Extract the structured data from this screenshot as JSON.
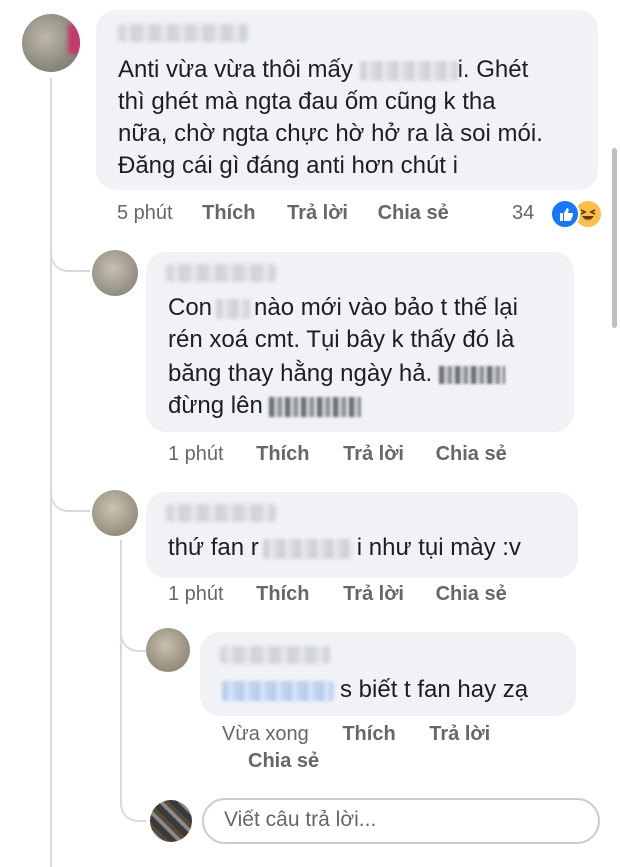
{
  "comments": [
    {
      "lines": [
        "Anti vừa vừa thôi mấy",
        "i. Ghét",
        "thì ghét mà ngta đau ốm cũng k tha",
        "nữa, chờ ngta chực hờ hở ra là soi mói.",
        "Đăng cái gì đáng anti hơn chút i"
      ],
      "time": "5 phút",
      "like": "Thích",
      "reply": "Trả lời",
      "share": "Chia sẻ",
      "reaction_count": "34",
      "reactions": [
        "like-icon",
        "haha-icon"
      ]
    },
    {
      "lines": [
        "Con",
        "nào mới vào bảo t thế lại",
        "rén xoá cmt. Tụi bây k thấy đó là",
        "băng thay hằng ngày hả.",
        "đừng lên"
      ],
      "time": "1 phút",
      "like": "Thích",
      "reply": "Trả lời",
      "share": "Chia sẻ"
    },
    {
      "lines": [
        "thứ fan r",
        "i như tụi mày :v"
      ],
      "time": "1 phút",
      "like": "Thích",
      "reply": "Trả lời",
      "share": "Chia sẻ"
    },
    {
      "lines": [
        "s biết t fan hay zạ"
      ],
      "time": "Vừa xong",
      "like": "Thích",
      "reply": "Trả lời",
      "share": "Chia sẻ"
    }
  ],
  "reply_box": {
    "placeholder": "Viết câu trả lời..."
  },
  "colors": {
    "bubble": "#f0f2f5",
    "meta": "#65676b",
    "text": "#1c1e21",
    "like_blue": "#1877f2"
  }
}
